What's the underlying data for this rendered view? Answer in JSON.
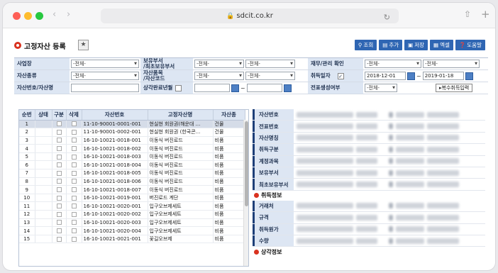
{
  "browser": {
    "url": "sdcit.co.kr"
  },
  "page": {
    "title": "고정자산 등록"
  },
  "toolbar": {
    "buttons": [
      {
        "label": "조회",
        "icon": "search-icon"
      },
      {
        "label": "추가",
        "icon": "add-icon"
      },
      {
        "label": "저장",
        "icon": "save-icon"
      },
      {
        "label": "엑셀",
        "icon": "excel-icon"
      },
      {
        "label": "도움말",
        "icon": "help-icon"
      }
    ]
  },
  "search": {
    "business_label": "사업장",
    "business_value": "-전체-",
    "holder_dept_label": "보유부서\n/최초보유부서",
    "holder_dept_value1": "-전체-",
    "holder_dept_value2": "-전체-",
    "finance_label": "재무/관리 확인",
    "finance_value1": "-전체-",
    "finance_value2": "-전체-",
    "asset_type_label": "자산종류",
    "asset_type_value": "-전체-",
    "item_code_label": "자산품목\n/자산코드",
    "item_code_value1": "-전체-",
    "item_code_value2": "-전체-",
    "acq_date_label": "취득일자",
    "acq_date_from": "2018-12-01",
    "acq_date_to": "2019-01-18",
    "asset_no_label": "자산번호/자산명",
    "asset_no_value": "",
    "depr_label": "상각완료년월",
    "voucher_label": "전표생성여부",
    "voucher_value": "-전체-",
    "multi_acq_label": "▸복수취득입력"
  },
  "grid": {
    "headers": [
      "순번",
      "상태",
      "구분",
      "삭제",
      "자산번호",
      "고정자산명",
      "자산종"
    ],
    "rows": [
      [
        "1",
        "11-10-90001-0001-001",
        "현실현 회원권(해운대 ...",
        "건물"
      ],
      [
        "2",
        "11-10-90001-0002-001",
        "현실현 회원권 (한국콘...",
        "건물"
      ],
      [
        "3",
        "16-10-10021-0018-001",
        "이동식 버진로드",
        "비품"
      ],
      [
        "4",
        "16-10-10021-0018-002",
        "이동식 버진로드",
        "비품"
      ],
      [
        "5",
        "16-10-10021-0018-003",
        "이동식 버진로드",
        "비품"
      ],
      [
        "6",
        "16-10-10021-0018-004",
        "이동식 버진로드",
        "비품"
      ],
      [
        "7",
        "16-10-10021-0018-005",
        "이동식 버진로드",
        "비품"
      ],
      [
        "8",
        "16-10-10021-0018-006",
        "이동식 버진로드",
        "비품"
      ],
      [
        "9",
        "16-10-10021-0018-007",
        "이동식 버진로드",
        "비품"
      ],
      [
        "10",
        "16-10-10021-0019-001",
        "버진로드 계단",
        "비품"
      ],
      [
        "11",
        "16-10-10021-0020-001",
        "입구오브제세트",
        "비품"
      ],
      [
        "12",
        "16-10-10021-0020-002",
        "입구오브제세트",
        "비품"
      ],
      [
        "13",
        "16-10-10021-0020-003",
        "입구오브제세트",
        "비품"
      ],
      [
        "14",
        "16-10-10021-0020-004",
        "입구오브제세트",
        "비품"
      ],
      [
        "15",
        "16-10-10021-0021-001",
        "꽃길오브제",
        "비품"
      ]
    ]
  },
  "detail": {
    "labels_top": [
      "자산번호",
      "전표번호",
      "자산명칭",
      "취득구분",
      "계정과목",
      "보유부서",
      "최초보유부서"
    ],
    "section_acq": "취득정보",
    "labels_acq": [
      "거래처",
      "규격",
      "취득원가",
      "수량"
    ],
    "section_depr": "상각정보"
  }
}
